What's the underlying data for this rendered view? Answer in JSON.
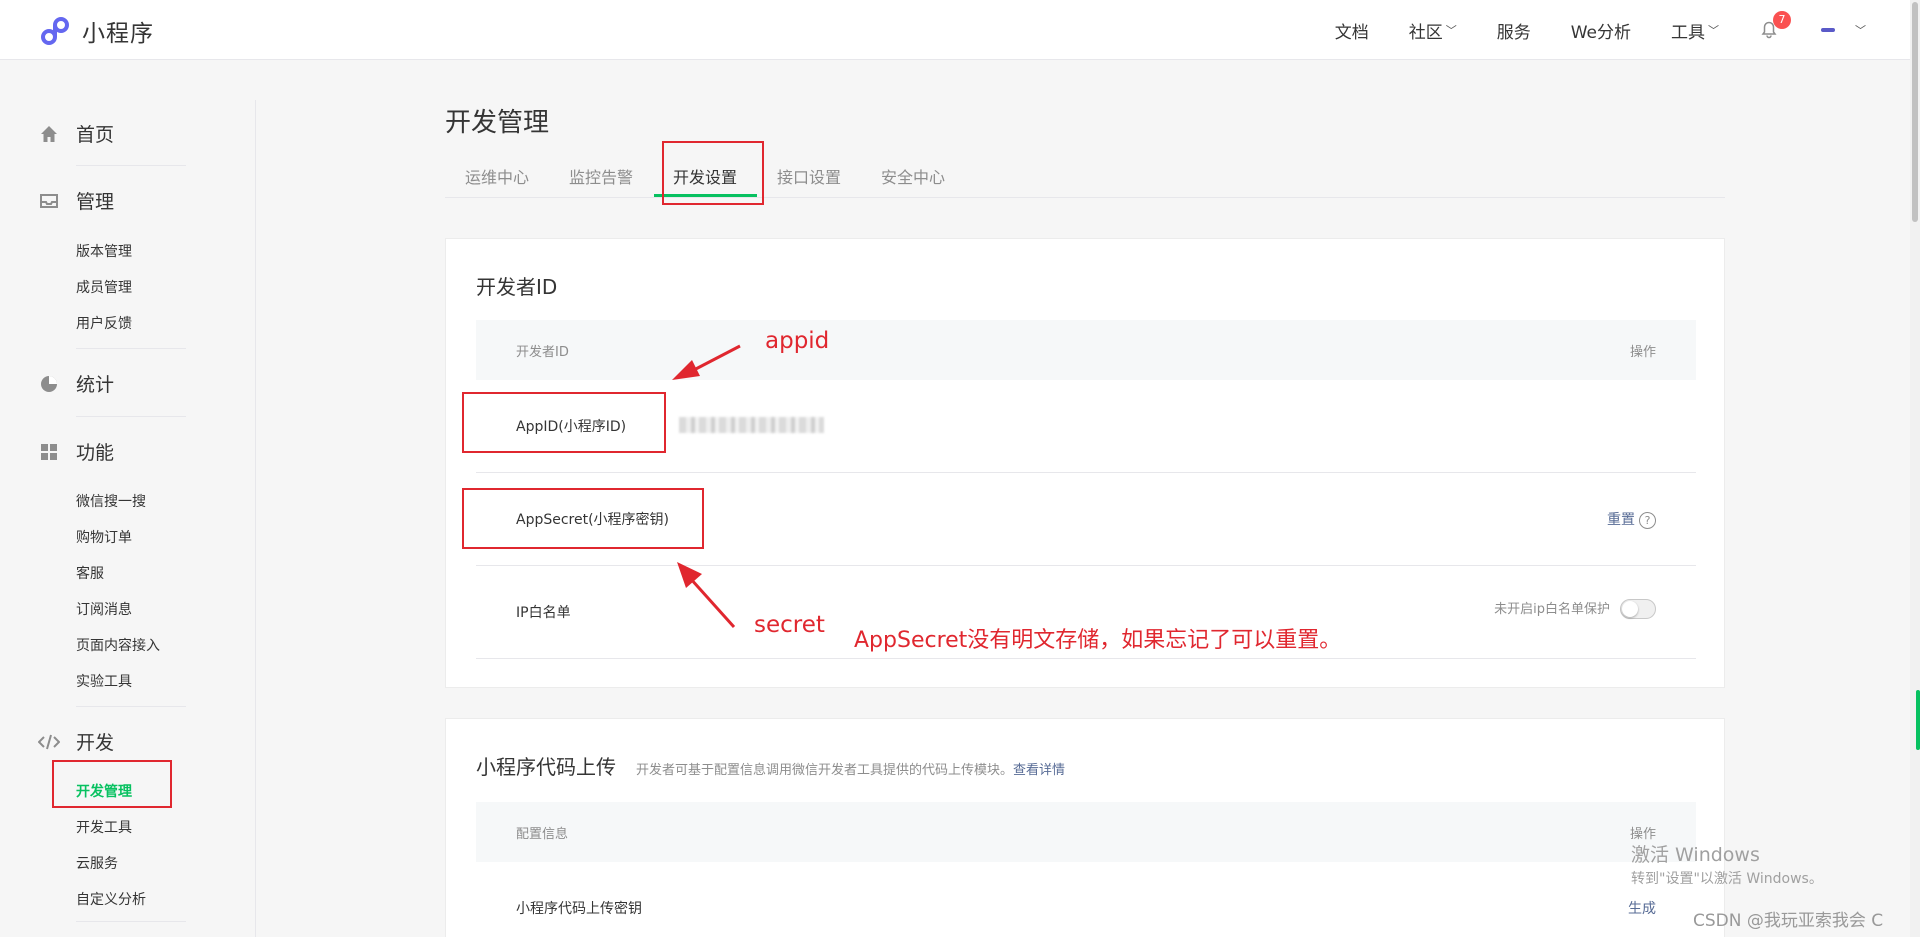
{
  "app": {
    "title": "小程序",
    "accent": "#07c160",
    "annotation_color": "#e0272f"
  },
  "topnav": {
    "items": [
      {
        "label": "文档",
        "has_dropdown": false
      },
      {
        "label": "社区",
        "has_dropdown": true
      },
      {
        "label": "服务",
        "has_dropdown": false
      },
      {
        "label": "We分析",
        "has_dropdown": false
      },
      {
        "label": "工具",
        "has_dropdown": true
      }
    ],
    "notification_count": "7"
  },
  "sidebar": {
    "sections": [
      {
        "label": "首页",
        "icon": "home-icon",
        "items": []
      },
      {
        "label": "管理",
        "icon": "inbox-icon",
        "items": [
          "版本管理",
          "成员管理",
          "用户反馈"
        ]
      },
      {
        "label": "统计",
        "icon": "pie-chart-icon",
        "items": []
      },
      {
        "label": "功能",
        "icon": "grid-icon",
        "items": [
          "微信搜一搜",
          "购物订单",
          "客服",
          "订阅消息",
          "页面内容接入",
          "实验工具"
        ]
      },
      {
        "label": "开发",
        "icon": "code-icon",
        "items": [
          "开发管理",
          "开发工具",
          "云服务",
          "自定义分析"
        ]
      }
    ],
    "active_item": "开发管理"
  },
  "main": {
    "title": "开发管理",
    "tabs": [
      "运维中心",
      "监控告警",
      "开发设置",
      "接口设置",
      "安全中心"
    ],
    "active_tab": "开发设置",
    "developer_id": {
      "title": "开发者ID",
      "header": {
        "col1": "开发者ID",
        "col2": "操作"
      },
      "rows": [
        {
          "label": "AppID(小程序ID)",
          "value": "",
          "action": ""
        },
        {
          "label": "AppSecret(小程序密钥)",
          "value": "",
          "action": "重置"
        },
        {
          "label": "IP白名单",
          "value": "",
          "action": "未开启ip白名单保护"
        }
      ]
    },
    "code_upload": {
      "title": "小程序代码上传",
      "desc": "开发者可基于配置信息调用微信开发者工具提供的代码上传模块。",
      "desc_link": "查看详情",
      "header": {
        "col1": "配置信息",
        "col2": "操作"
      },
      "rows": [
        {
          "label": "小程序代码上传密钥",
          "action": "生成"
        }
      ]
    }
  },
  "annotations": {
    "appid": "appid",
    "secret": "secret",
    "note": "AppSecret没有明文存储，如果忘记了可以重置。"
  },
  "watermark": {
    "line1": "激活 Windows",
    "line2": "转到\"设置\"以激活 Windows。",
    "csdn": "CSDN @我玩亚索我会 C"
  }
}
